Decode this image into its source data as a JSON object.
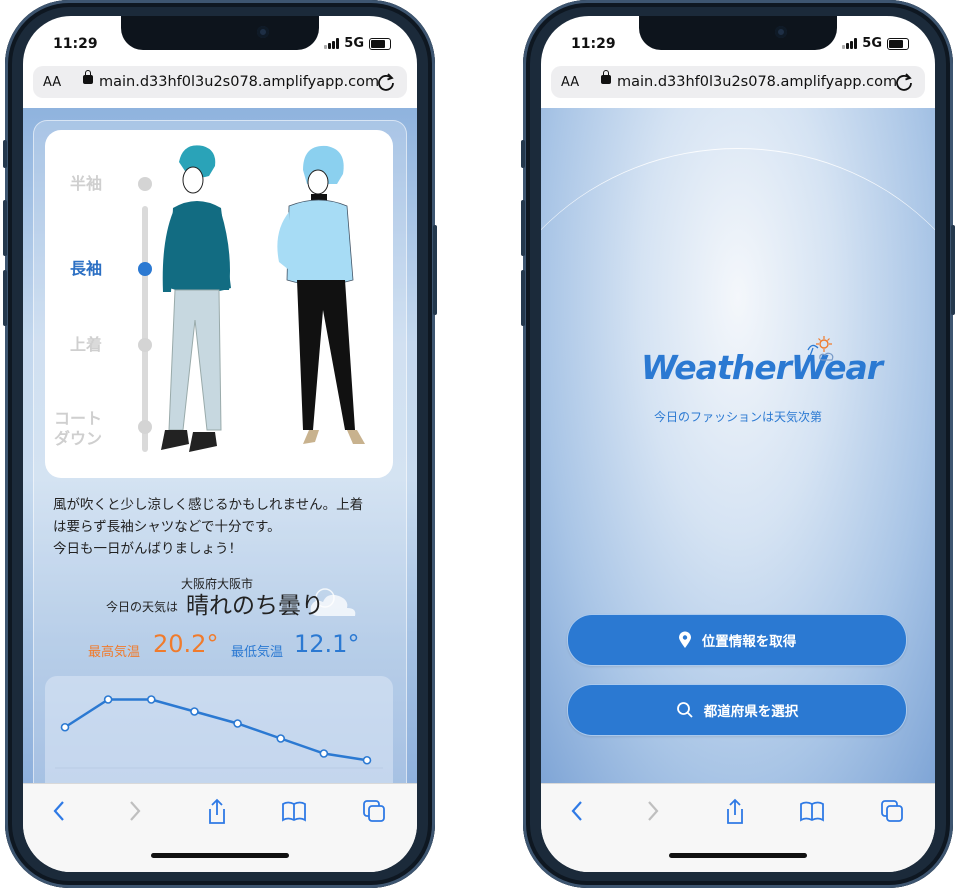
{
  "status": {
    "time": "11:29",
    "network": "5G"
  },
  "browser": {
    "aa": "AA",
    "url": "main.d33hf0l3u2s078.amplifyapp.com"
  },
  "left": {
    "slider": {
      "items": [
        {
          "label": "半袖",
          "active": false
        },
        {
          "label": "長袖",
          "active": true
        },
        {
          "label": "上着",
          "active": false
        },
        {
          "label": "コート\nダウン",
          "active": false
        }
      ]
    },
    "advice": [
      "風が吹くと少し涼しく感じるかもしれません。上着",
      "は要らず長袖シャツなどで十分です。",
      "今日も一日がんばりましょう！"
    ],
    "city": "大阪府大阪市",
    "weather_label": "今日の天気は",
    "weather_value": "晴れのち曇り",
    "max_label": "最高気温",
    "max_value": "20.2°",
    "min_label": "最低気温",
    "min_value": "12.1°"
  },
  "chart_data": {
    "type": "line",
    "x": [
      1,
      2,
      3,
      4,
      5,
      6,
      7,
      8
    ],
    "values": [
      16.5,
      20.2,
      20.2,
      18.6,
      17.0,
      15.0,
      13.0,
      12.1
    ],
    "ylim": [
      10,
      22
    ],
    "color": "#2b79d2"
  },
  "right": {
    "logo": "WeatherWear",
    "tagline": "今日のファッションは天気次第",
    "btn_location": "位置情報を取得",
    "btn_prefecture": "都道府県を選択"
  },
  "colors": {
    "accent": "#2b79d2",
    "max": "#f07b2c"
  }
}
